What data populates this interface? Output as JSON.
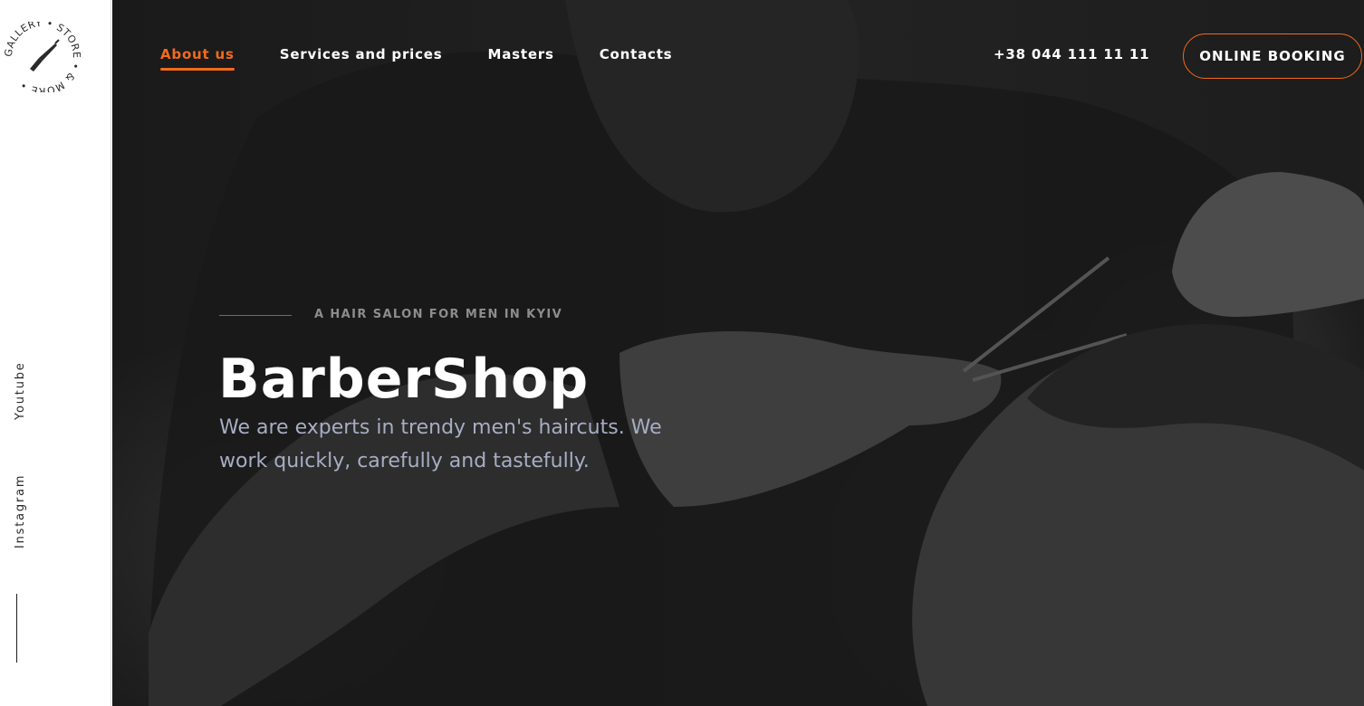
{
  "logo": {
    "ring_text": "GALLERY • STORE • & MORE •"
  },
  "sidebar": {
    "socials": [
      {
        "label": "Youtube"
      },
      {
        "label": "Instagram"
      }
    ]
  },
  "nav": {
    "items": [
      {
        "label": "About us",
        "active": true
      },
      {
        "label": "Services and prices",
        "active": false
      },
      {
        "label": "Masters",
        "active": false
      },
      {
        "label": "Contacts",
        "active": false
      }
    ],
    "phone": "+38 044 111 11 11",
    "booking_label": "ONLINE BOOKING"
  },
  "hero": {
    "tagline": "A HAIR SALON FOR MEN IN KYIV",
    "title": "BarberShop",
    "description": "We are experts in trendy men's haircuts. We work quickly, carefully and tastefully."
  },
  "colors": {
    "accent": "#f26a1b",
    "hero_background": "#262626",
    "description_text": "#a7adc3",
    "sidebar_background": "#ffffff"
  },
  "icons": [
    "razor-icon"
  ]
}
